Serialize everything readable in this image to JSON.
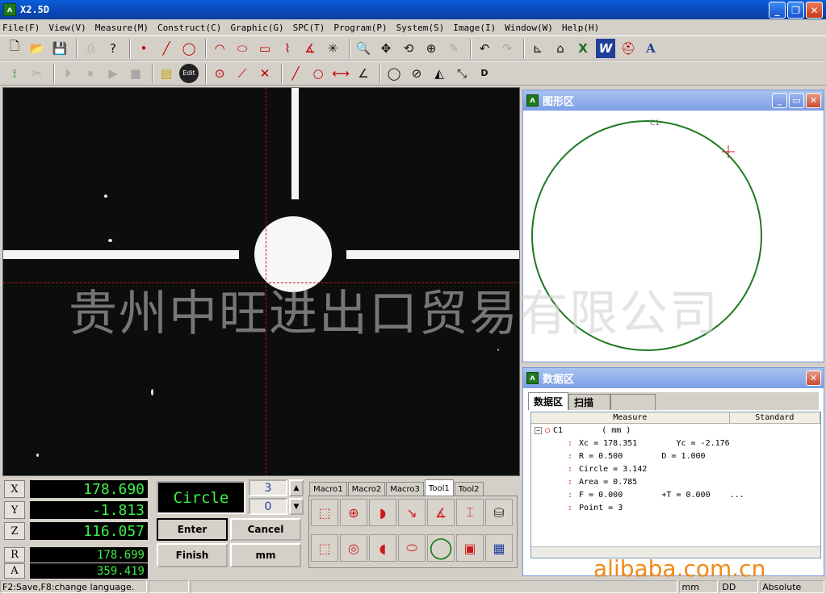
{
  "window": {
    "title": "X2.5D",
    "app_icon": "AH"
  },
  "menu": [
    "File(F)",
    "View(V)",
    "Measure(M)",
    "Construct(C)",
    "Graphic(G)",
    "SPC(T)",
    "Program(P)",
    "System(S)",
    "Image(I)",
    "Window(W)",
    "Help(H)"
  ],
  "toolbar1_icons": [
    "new-icon",
    "open-icon",
    "save-icon",
    "help-icon",
    "point-icon",
    "line-icon",
    "circle-icon",
    "arc-icon",
    "ellipse-icon",
    "rectangle-icon",
    "slot-icon",
    "angle-icon",
    "auto-icon",
    "zoom-icon",
    "pan-icon",
    "rotate-icon",
    "target-icon",
    "erase-icon",
    "undo-icon",
    "redo-icon",
    "axis-icon",
    "export-icon",
    "excel-icon",
    "word-icon",
    "print-icon",
    "font-icon"
  ],
  "toolbar2": {
    "edit_label": "Edit",
    "dist_label": "D"
  },
  "graphics_panel": {
    "title": "图形区",
    "circle_label": "C1"
  },
  "data_panel": {
    "title": "数据区",
    "tabs": [
      "数据区",
      "扫描"
    ],
    "columns": [
      "Measure",
      "Standard"
    ],
    "root": "C1        ( mm )",
    "rows": [
      "Xc = 178.351        Yc = -2.176",
      "R = 0.500        D = 1.000",
      "Circle = 3.142",
      "Area = 0.785",
      "F = 0.000        +T = 0.000    ...",
      "Point = 3"
    ]
  },
  "watermark": "贵州中旺进出口贸易有限公司",
  "alibaba_watermark": "alibaba.com.cn",
  "coords": {
    "X": "178.690",
    "Y": "-1.813",
    "Z": "116.057",
    "R": "178.699",
    "A": "359.419"
  },
  "measure": {
    "mode": "Circle",
    "count": "3",
    "count2": "0",
    "enter": "Enter",
    "cancel": "Cancel",
    "finish": "Finish",
    "unit": "mm"
  },
  "tool_tabs": [
    "Macro1",
    "Macro2",
    "Macro3",
    "Tool1",
    "Tool2"
  ],
  "status": {
    "hint": "F2:Save,F8:change language.",
    "unit": "mm",
    "dd": "DD",
    "mode": "Absolute"
  }
}
